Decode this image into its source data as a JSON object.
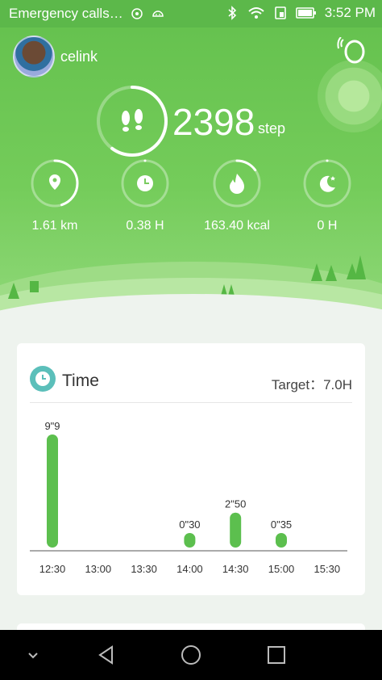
{
  "status_bar": {
    "notification": "Emergency calls…",
    "time": "3:52 PM"
  },
  "header": {
    "username": "celink",
    "steps": "2398",
    "steps_unit": "step",
    "steps_progress": 0.6
  },
  "stats": [
    {
      "icon": "location-pin-icon",
      "value": "1.61 km",
      "progress": 0.45
    },
    {
      "icon": "clock-icon",
      "value": "0.38 H",
      "progress": 0.0
    },
    {
      "icon": "flame-icon",
      "value": "163.40 kcal",
      "progress": 0.15
    },
    {
      "icon": "moon-icon",
      "value": "0 H",
      "progress": 0.0
    }
  ],
  "time_card": {
    "title": "Time",
    "target": "Target：7.0H"
  },
  "chart_data": {
    "type": "bar",
    "categories": [
      "12:30",
      "13:00",
      "13:30",
      "14:00",
      "14:30",
      "15:00",
      "15:30"
    ],
    "values_minutes": [
      9.15,
      0,
      0,
      0.5,
      2.83,
      0.58,
      0
    ],
    "labels": [
      "9\"9",
      "",
      "",
      "0\"30",
      "2\"50",
      "0\"35",
      ""
    ],
    "xlabel": "",
    "ylabel": ""
  },
  "colors": {
    "accent": "#5cb84a",
    "bar": "#5cbf4e",
    "card_icon": "#5bbfba"
  },
  "navbar": {
    "icons": [
      "chevron-down-icon",
      "back-icon",
      "home-icon",
      "recents-icon"
    ]
  }
}
